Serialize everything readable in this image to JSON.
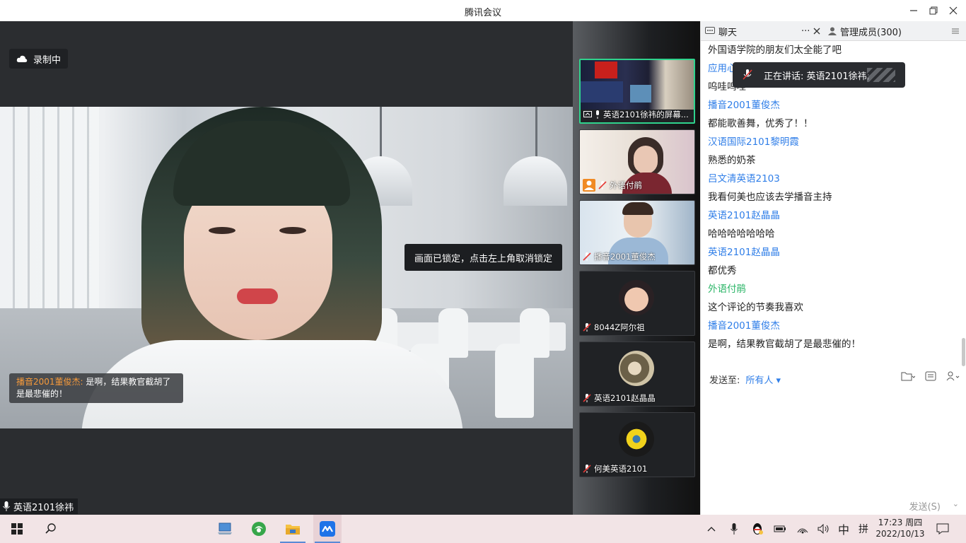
{
  "window": {
    "title": "腾讯会议"
  },
  "recording": {
    "label": "录制中"
  },
  "main_video": {
    "chat_overlay": {
      "sender": "播音2001董俊杰:",
      "text": " 是啊，结果教官截胡了是最悲催的！"
    },
    "lock_tip": "画面已锁定，点击左上角取消锁定",
    "speaker_name": "英语2101徐祎"
  },
  "thumbnails": [
    {
      "label": "英语2101徐祎的屏幕...",
      "active": true
    },
    {
      "label": "外语付鹃"
    },
    {
      "label": "播音2001董俊杰"
    },
    {
      "label": "8044Z阿尔祖"
    },
    {
      "label": "英语2101赵晶晶"
    },
    {
      "label": "何美英语2101"
    }
  ],
  "chat": {
    "tab_chat": "聊天",
    "tab_more": "···",
    "tab_members": "管理成员(300)",
    "messages": [
      {
        "kind": "text",
        "text": "外国语学院的朋友们太全能了吧"
      },
      {
        "kind": "name",
        "text": "应用心理2201郝冉"
      },
      {
        "kind": "text",
        "text": "呜哇呜哇"
      },
      {
        "kind": "name",
        "text": "播音2001董俊杰"
      },
      {
        "kind": "text",
        "text": "都能歌善舞，优秀了！！"
      },
      {
        "kind": "name",
        "text": "汉语国际2101黎明霞"
      },
      {
        "kind": "text",
        "text": "熟悉的奶茶"
      },
      {
        "kind": "name",
        "text": "吕文清英语2103"
      },
      {
        "kind": "text",
        "text": "我看何美也应该去学播音主持"
      },
      {
        "kind": "name",
        "text": "英语2101赵晶晶"
      },
      {
        "kind": "text",
        "text": "哈哈哈哈哈哈哈"
      },
      {
        "kind": "name",
        "text": "英语2101赵晶晶"
      },
      {
        "kind": "text",
        "text": "都优秀"
      },
      {
        "kind": "host",
        "text": "外语付鹃"
      },
      {
        "kind": "text",
        "text": "这个评论的节奏我喜欢"
      },
      {
        "kind": "name",
        "text": "播音2001董俊杰"
      },
      {
        "kind": "text",
        "text": "是啊，结果教官截胡了是最悲催的！"
      }
    ],
    "speaking_tip": "正在讲话: 英语2101徐祎;",
    "send_to_label": "发送至:",
    "send_to_target": "所有人",
    "send_button": "发送(S)"
  },
  "taskbar": {
    "ime_lang": "中",
    "ime_mode": "拼",
    "time": "17:23 周四",
    "date": "2022/10/13"
  },
  "colors": {
    "accent_blue": "#2f7ee8",
    "host_green": "#2bb567",
    "active_border": "#2fd38d",
    "sender_orange": "#f59a3b"
  }
}
